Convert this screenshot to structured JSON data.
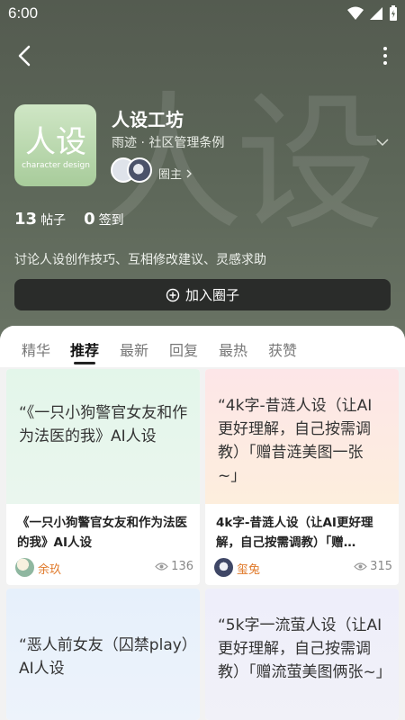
{
  "status": {
    "time": "6:00"
  },
  "circle": {
    "cover_main": "人设",
    "cover_sub": "character design",
    "title": "人设工坊",
    "subtitle": "雨迹 · 社区管理条例",
    "owner_label": "圈主",
    "posts_count": "13",
    "posts_label": "帖子",
    "checkin_count": "0",
    "checkin_label": "签到",
    "description": "讨论人设创作技巧、互相修改建议、灵感求助",
    "join_label": "加入圈子",
    "watermark": "人设"
  },
  "tabs": [
    {
      "label": "精华"
    },
    {
      "label": "推荐"
    },
    {
      "label": "最新"
    },
    {
      "label": "回复"
    },
    {
      "label": "最热"
    },
    {
      "label": "获赞"
    }
  ],
  "cards": [
    {
      "quote": "“《一只小狗警官女友和作为法医的我》AI人设",
      "title": "《一只小狗警官女友和作为法医的我》AI人设",
      "user": "余玖",
      "views": "136"
    },
    {
      "quote": "“4k字-昔涟人设（让AI更好理解，自己按需调教）「赠昔涟美图一张~」",
      "title": "4k字-昔涟人设（让AI更好理解，自己按需调教）「赠…",
      "user": "玺兔",
      "views": "315"
    },
    {
      "quote": "“恶人前女友（囚禁play）AI人设",
      "title": "",
      "user": "",
      "views": ""
    },
    {
      "quote": "“5k字一流萤人设（让AI更好理解，自己按需调教）「赠流萤美图俩张~」",
      "title": "",
      "user": "",
      "views": ""
    }
  ],
  "colors": {
    "header": "#5c6658",
    "join_button": "#2a2c2a",
    "username": "#e07a2b",
    "card1_bg": "#e6f6ec",
    "card2_bg": "#fde9ea",
    "card3_bg": "#eaf2fb",
    "card4_bg": "#eeeef8"
  }
}
